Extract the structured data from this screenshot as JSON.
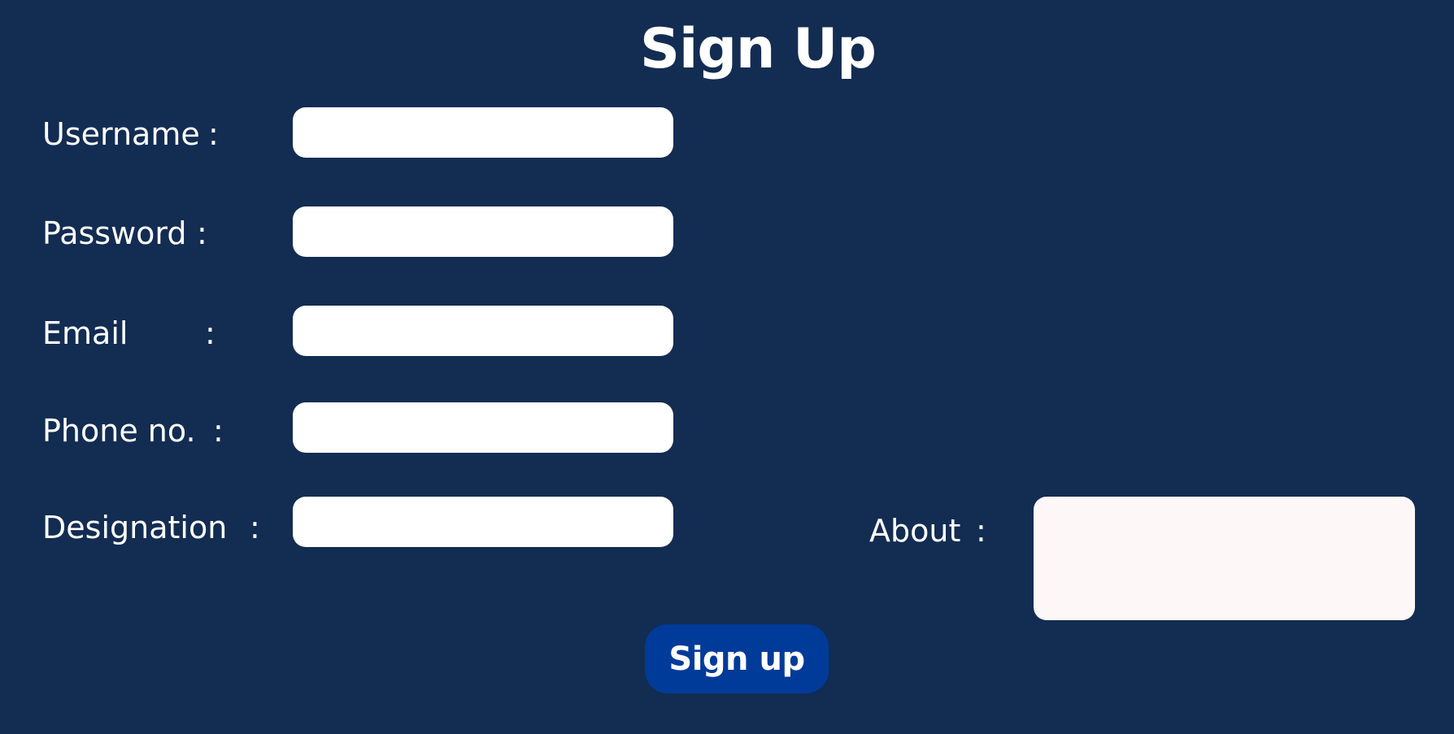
{
  "title": "Sign Up",
  "fields": {
    "username": {
      "label": "Username",
      "colon": ":",
      "value": ""
    },
    "password": {
      "label": "Password",
      "colon": ":",
      "value": ""
    },
    "email": {
      "label": "Email",
      "colon": ":",
      "value": ""
    },
    "phone": {
      "label": "Phone no.",
      "colon": ":",
      "value": ""
    },
    "designation": {
      "label": "Designation",
      "colon": ":",
      "value": ""
    },
    "about": {
      "label": "About",
      "colon": ":",
      "value": ""
    }
  },
  "submit_label": "Sign up",
  "colors": {
    "background": "#132c52",
    "input": "#ffffff",
    "about_input": "#fdf8f7",
    "button": "#003b99",
    "text": "#ffffff"
  }
}
